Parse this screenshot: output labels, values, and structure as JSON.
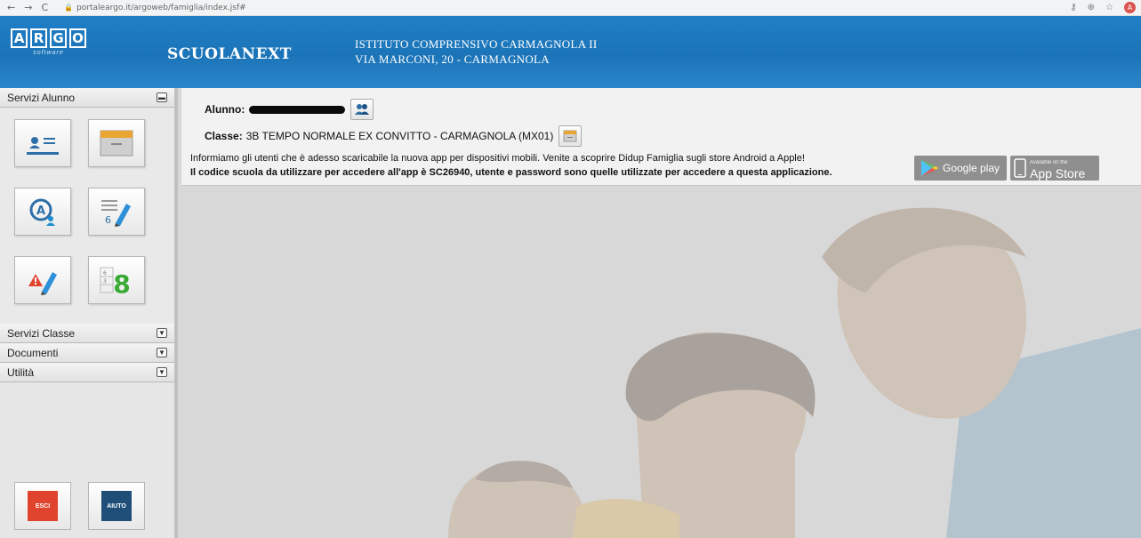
{
  "browser": {
    "url": "portaleargo.it/argoweb/famiglia/index.jsf#",
    "avatar_initial": "A"
  },
  "header": {
    "argo_letters": [
      "A",
      "R",
      "G",
      "O"
    ],
    "argo_subtitle": "software",
    "product": "SCUOLANEXT",
    "school_line1": "ISTITUTO COMPRENSIVO CARMAGNOLA II",
    "school_line2": "VIA MARCONI, 20 - CARMAGNOLA",
    "colors": {
      "header_blue": "#1f7fc6"
    }
  },
  "sidebar": {
    "sections": [
      {
        "label": "Servizi Alunno",
        "expanded": true
      },
      {
        "label": "Servizi Classe",
        "expanded": false
      },
      {
        "label": "Documenti",
        "expanded": false
      },
      {
        "label": "Utilità",
        "expanded": false
      }
    ],
    "tiles": [
      {
        "icon": "student-card-icon"
      },
      {
        "icon": "register-icon"
      },
      {
        "icon": "absences-icon"
      },
      {
        "icon": "grades-icon"
      },
      {
        "icon": "notes-icon"
      },
      {
        "icon": "report-card-icon"
      }
    ],
    "logout_label": "ESCI",
    "help_label": "AIUTO",
    "colors": {
      "esci": "#e0442f",
      "aiuto": "#1f4f78"
    }
  },
  "main": {
    "alunno_label": "Alunno:",
    "classe_label": "Classe:",
    "classe_value": "3B TEMPO NORMALE EX CONVITTO - CARMAGNOLA (MX01)",
    "info_line1": "Informiamo gli utenti che è adesso scaricabile la nuova app per dispositivi mobili. Venite a scoprire Didup Famiglia sugli store Android a Apple!",
    "info_line2": "Il codice scuola da utilizzare per accedere all'app è SC26940, utente e password sono quelle utilizzate per accedere a questa applicazione.",
    "google_play_label": "Google play",
    "app_store_small": "Available on the",
    "app_store_label": "App Store"
  }
}
